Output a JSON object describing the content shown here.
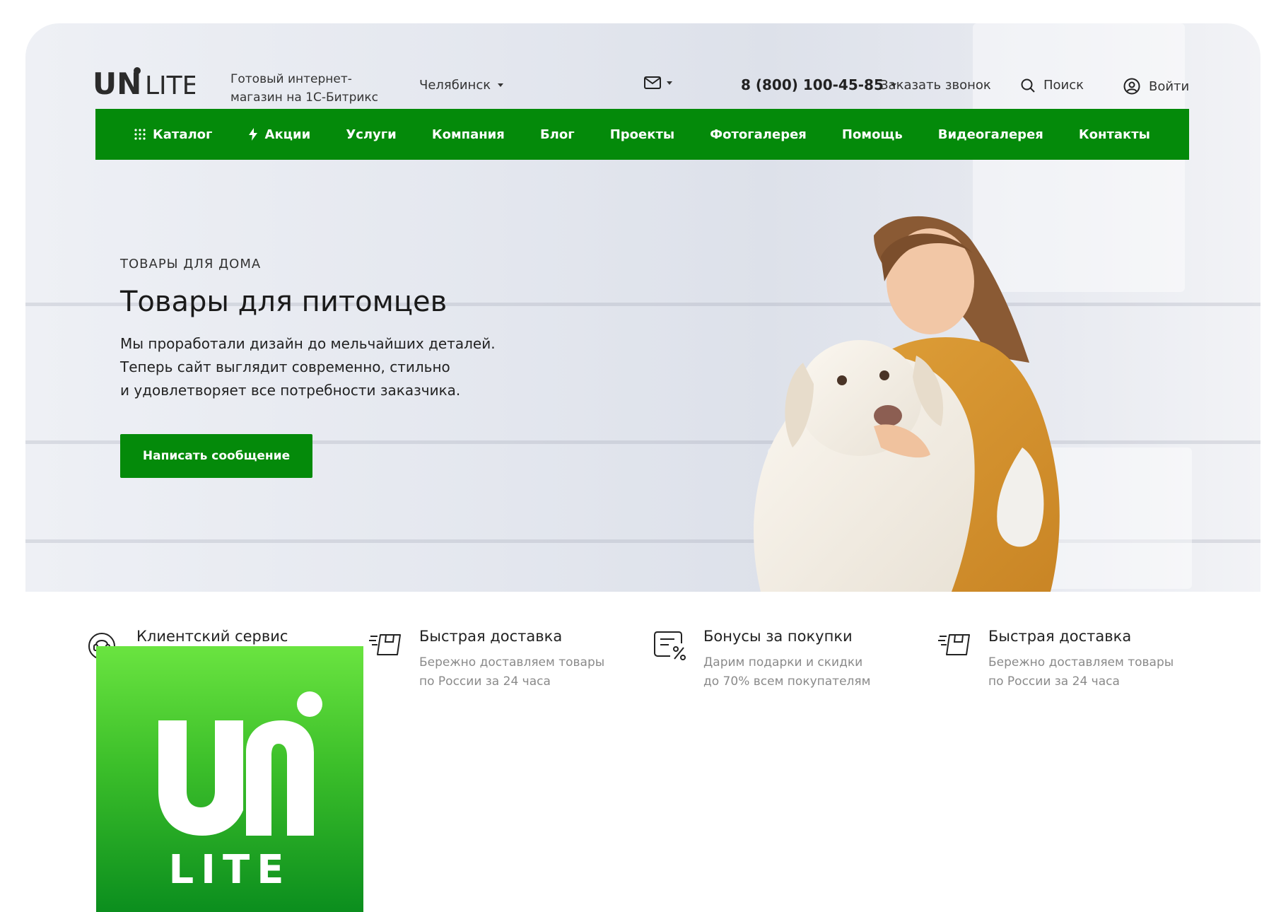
{
  "header": {
    "brand": "UNi LITE",
    "tagline": "Готовый интернет-магазин на 1С-Битрикс",
    "city": "Челябинск",
    "phone": "8 (800) 100-45-85",
    "callback_label": "Заказать звонок",
    "search_label": "Поиск",
    "login_label": "Войти"
  },
  "nav": {
    "items": [
      {
        "label": "Каталог",
        "icon": "grid-icon"
      },
      {
        "label": "Акции",
        "icon": "lightning-icon"
      },
      {
        "label": "Услуги"
      },
      {
        "label": "Компания"
      },
      {
        "label": "Блог"
      },
      {
        "label": "Проекты"
      },
      {
        "label": "Фотогалерея"
      },
      {
        "label": "Помощь"
      },
      {
        "label": "Видеогалерея"
      },
      {
        "label": "Контакты"
      }
    ]
  },
  "hero": {
    "eyebrow": "ТОВАРЫ ДЛЯ ДОМА",
    "title": "Товары для питомцев",
    "description_lines": [
      "Мы проработали дизайн до мельчайших деталей.",
      "Теперь сайт выглядит современно, стильно",
      "и удовлетворяет все потребности заказчика."
    ],
    "cta_label": "Написать сообщение"
  },
  "features": [
    {
      "icon": "support-icon",
      "title": "Клиентский сервис",
      "lines": [
        "",
        ""
      ]
    },
    {
      "icon": "delivery-icon",
      "title": "Быстрая доставка",
      "lines": [
        "Бережно доставляем товары",
        "по России за 24 часа"
      ]
    },
    {
      "icon": "bonus-icon",
      "title": "Бонусы за покупки",
      "lines": [
        "Дарим подарки и скидки",
        "до 70% всем покупателям"
      ]
    },
    {
      "icon": "delivery-icon",
      "title": "Быстрая доставка",
      "lines": [
        "Бережно доставляем товары",
        "по России за 24 часа"
      ]
    }
  ],
  "brand_tile": {
    "text": "UNi LITE"
  },
  "colors": {
    "accent": "#048a0a",
    "tile_top": "#6ae440",
    "tile_bottom": "#0b8e1e",
    "muted_text": "#8a8a8a"
  }
}
